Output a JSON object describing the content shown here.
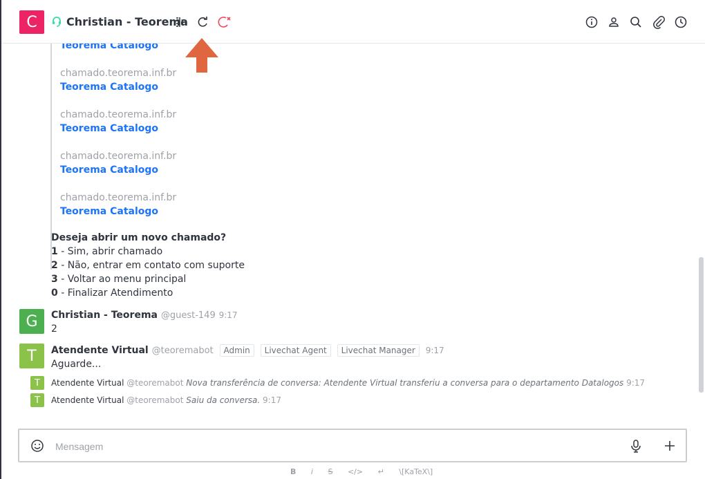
{
  "header": {
    "avatar_letter": "C",
    "title": "Christian - Teorema",
    "colors": {
      "avatar": "#ec2364",
      "headset": "#2de0a5",
      "arrow": "#e06640"
    }
  },
  "messages": {
    "links": [
      {
        "host": "",
        "title": "Teorema Catalogo"
      },
      {
        "host": "chamado.teorema.inf.br",
        "title": "Teorema Catalogo"
      },
      {
        "host": "chamado.teorema.inf.br",
        "title": "Teorema Catalogo"
      },
      {
        "host": "chamado.teorema.inf.br",
        "title": "Teorema Catalogo"
      },
      {
        "host": "chamado.teorema.inf.br",
        "title": "Teorema Catalogo"
      }
    ],
    "question": "Deseja abrir um novo chamado?",
    "options": [
      {
        "num": "1",
        "text": " - Sim, abrir chamado"
      },
      {
        "num": "2",
        "text": " - Não, entrar em contato com suporte"
      },
      {
        "num": "3",
        "text": " - Voltar ao menu principal"
      },
      {
        "num": "0",
        "text": " - Finalizar Atendimento"
      }
    ],
    "guest_msg": {
      "avatar_letter": "G",
      "name": "Christian - Teorema",
      "handle": "@guest-149",
      "time": "9:17",
      "text": "2"
    },
    "bot_msg": {
      "avatar_letter": "T",
      "name": "Atendente Virtual",
      "handle": "@teoremabot",
      "roles": [
        "Admin",
        "Livechat Agent",
        "Livechat Manager"
      ],
      "time": "9:17",
      "text": "Aguarde..."
    },
    "system": [
      {
        "avatar_letter": "T",
        "name": "Atendente Virtual",
        "handle": "@teoremabot",
        "text": "Nova transferência de conversa: Atendente Virtual transferiu a conversa para o departamento Datalogos",
        "time": "9:17"
      },
      {
        "avatar_letter": "T",
        "name": "Atendente Virtual",
        "handle": "@teoremabot",
        "text": "Saiu da conversa.",
        "time": "9:17"
      }
    ]
  },
  "composer": {
    "placeholder": "Mensagem",
    "format": {
      "bold": "B",
      "italic": "i",
      "strike": "S",
      "code": "</>",
      "newline": "↵",
      "katex": "\\[KaTeX\\]"
    }
  }
}
